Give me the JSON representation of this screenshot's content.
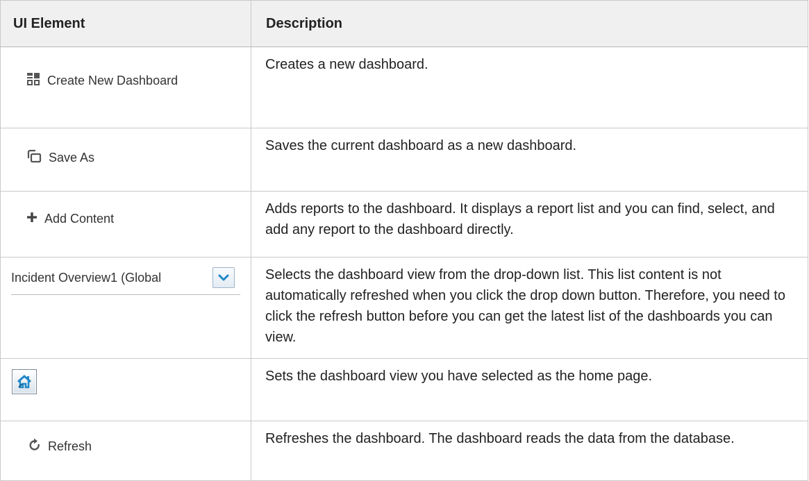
{
  "table": {
    "headers": [
      "UI Element",
      "Description"
    ],
    "rows": [
      {
        "element_label": "Create New Dashboard",
        "icon": "dashboard-grid-icon",
        "description": "Creates a new dashboard."
      },
      {
        "element_label": "Save As",
        "icon": "save-as-icon",
        "description": "Saves the current dashboard as a new dashboard."
      },
      {
        "element_label": "Add Content",
        "icon": "plus-icon",
        "description": "Adds reports to the dashboard. It displays a report list and you can find, select, and add any report to the dashboard directly."
      },
      {
        "element_label": "Incident Overview1 (Global",
        "icon": "chevron-down-icon",
        "description": "Selects the dashboard view from the drop-down list. This list content is not automatically refreshed when you click the drop down button. Therefore, you need to click the refresh button before you can get the latest list of the dashboards you can view."
      },
      {
        "element_label": "",
        "icon": "home-page-icon",
        "description": "Sets the dashboard view you have selected as the home page."
      },
      {
        "element_label": "Refresh",
        "icon": "refresh-icon",
        "description": "Refreshes the dashboard. The dashboard reads the data from the database."
      }
    ]
  },
  "colors": {
    "header_bg": "#f0f0f0",
    "border": "#c9c9c9",
    "icon_gray": "#555555",
    "accent_blue": "#1e88c8"
  }
}
